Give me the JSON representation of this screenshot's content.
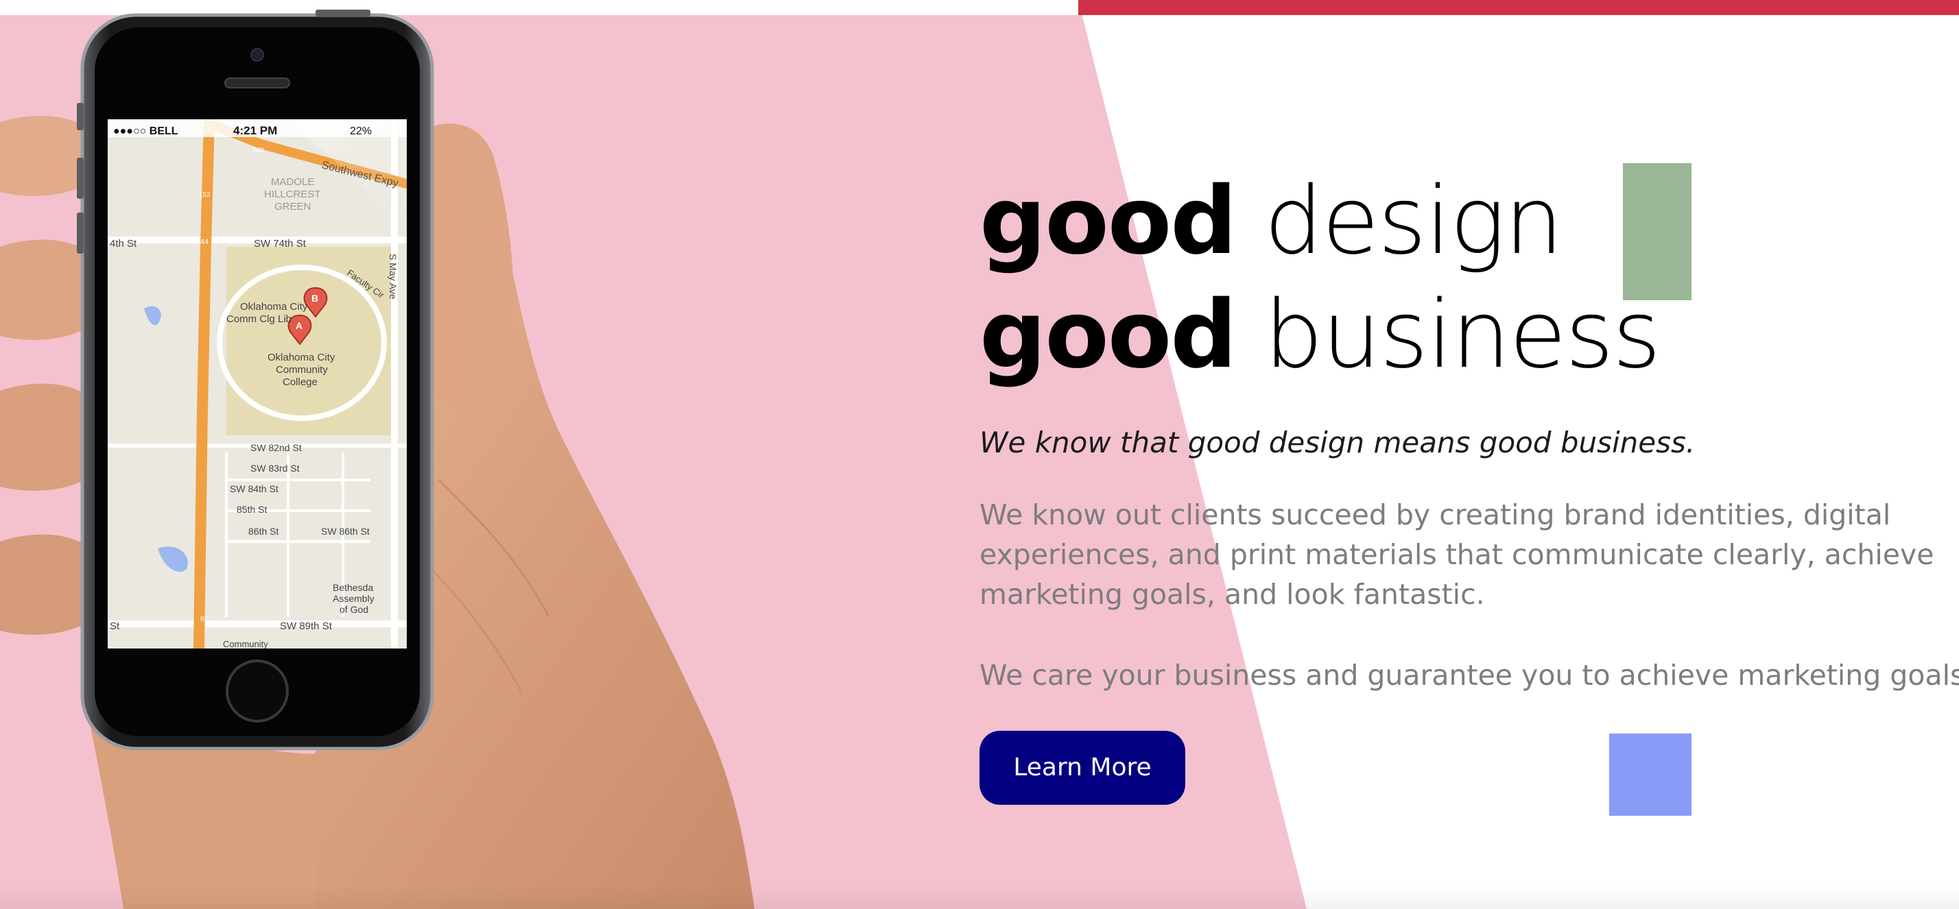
{
  "colors": {
    "pink_panel": "#f4c1cf",
    "top_accent": "#cf3248",
    "green_square": "#9bb696",
    "blue_square": "#8a9bf7",
    "button_bg": "#020080",
    "button_text": "#ffffff",
    "body_text": "#7d7d7d"
  },
  "hero": {
    "headline": {
      "line1_bold": "good",
      "line1_light": "design",
      "line2_bold": "good",
      "line2_light": "business"
    },
    "tagline": "We know that good design means good business.",
    "paragraph1": "We know out clients succeed by creating brand identities, digital experiences, and print materials that communicate clearly, achieve marketing goals, and look fantastic.",
    "paragraph2": "We care your business and guarantee you to achieve marketing goals",
    "cta_label": "Learn More"
  },
  "phone": {
    "status": {
      "carrier": "●●●○○ BELL",
      "time": "4:21 PM",
      "battery": "22%"
    },
    "map_labels": {
      "madole": "MADOLE",
      "hillcrest": "HILLCREST",
      "green": "GREEN",
      "southwest_expy": "Southwest Expy",
      "sw_74th": "SW 74th St",
      "th_st": "4th St",
      "faculty_cir": "Faculty Cir",
      "okc_lib": "Oklahoma City",
      "okc_lib2": "Comm Clg Lib",
      "okc_college1": "Oklahoma City",
      "okc_college2": "Community",
      "okc_college3": "College",
      "s_may_ave": "S May Ave",
      "sw_82nd": "SW 82nd St",
      "sw_83rd": "SW 83rd St",
      "sw_84th": "SW 84th St",
      "st_85th": "85th St",
      "st_86th": "86th St",
      "sw_86th": "SW 86th St",
      "sw_89th": "SW 89th St",
      "bethesda1": "Bethesda",
      "bethesda2": "Assembly",
      "bethesda3": "of God",
      "community": "Community",
      "st": "St",
      "marker_a": "A",
      "marker_b": "B",
      "hwy_44": "44",
      "hwy_62": "62",
      "hwy_152": "152",
      "hwy_240": "240"
    }
  }
}
